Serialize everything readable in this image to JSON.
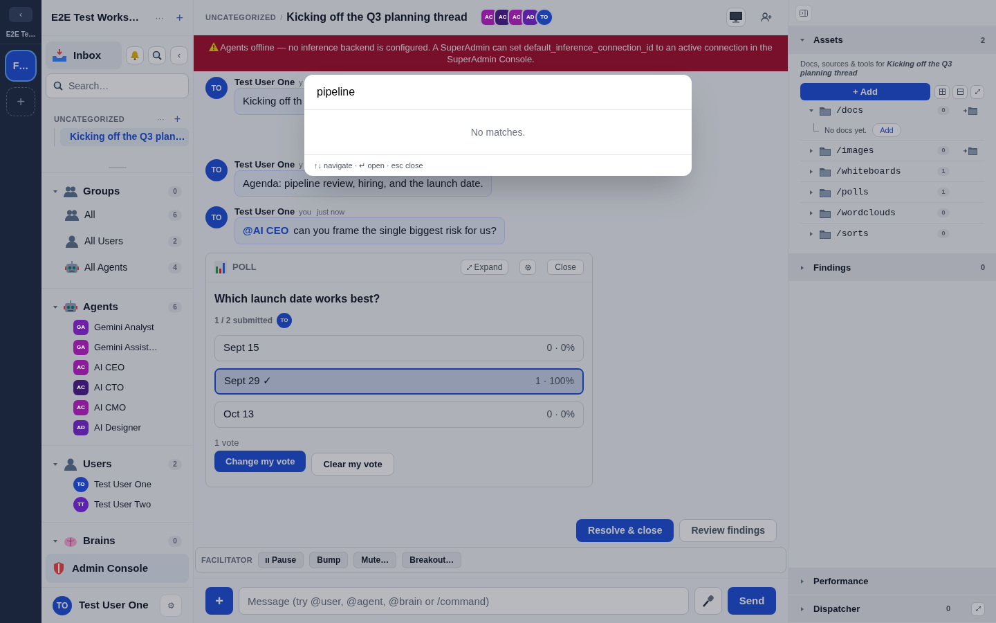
{
  "rail": {
    "back": "‹",
    "workspace_short": "E2E Te…",
    "workspaces": [
      {
        "label": "F…",
        "selected": true
      }
    ],
    "add": "+"
  },
  "sidebar": {
    "title": "E2E Test Works…",
    "more": "···",
    "add": "+",
    "inbox": "Inbox",
    "search": {
      "placeholder": "Search…"
    },
    "category": {
      "label": "UNCATEGORIZED",
      "more": "···",
      "add": "+"
    },
    "threads": [
      {
        "label": "Kicking off the Q3 plan…",
        "selected": true
      }
    ],
    "sections": [
      {
        "title": "Groups",
        "count": "0",
        "expanded": true,
        "items": [
          {
            "kind": "icon",
            "label": "All",
            "count": "6"
          },
          {
            "kind": "icon",
            "label": "All Users",
            "count": "2"
          },
          {
            "kind": "icon",
            "label": "All Agents",
            "count": "4"
          }
        ]
      },
      {
        "title": "Agents",
        "count": "6",
        "expanded": true,
        "items": [
          {
            "kind": "avatar",
            "initials": "GA",
            "label": "Gemini Analyst",
            "color": "#6b21a8"
          },
          {
            "kind": "avatar",
            "initials": "GA",
            "label": "Gemini Assist…",
            "color": "#8b1d9a"
          },
          {
            "kind": "avatar",
            "initials": "AC",
            "label": "AI CEO",
            "color": "#8b1d9a"
          },
          {
            "kind": "avatar",
            "initials": "AC",
            "label": "AI CTO",
            "color": "#3b1a6e"
          },
          {
            "kind": "avatar",
            "initials": "AC",
            "label": "AI CMO",
            "color": "#8b1d9a"
          },
          {
            "kind": "avatar",
            "initials": "AD",
            "label": "AI Designer",
            "color": "#5b21a0"
          }
        ]
      },
      {
        "title": "Users",
        "count": "2",
        "expanded": true,
        "items": [
          {
            "kind": "avatar",
            "initials": "TO",
            "label": "Test User One",
            "color": "#1e40af"
          },
          {
            "kind": "avatar",
            "initials": "TT",
            "label": "Test User Two",
            "color": "#5b23b0"
          }
        ]
      },
      {
        "title": "Brains",
        "count": "0",
        "expanded": true
      }
    ],
    "admin": "Admin Console",
    "user": {
      "initials": "TO",
      "name": "Test User One",
      "settings": "⚙"
    }
  },
  "header": {
    "category": "UNCATEGORIZED",
    "separator": "/",
    "title": "Kicking off the Q3 planning thread",
    "participants": [
      {
        "initials": "AC",
        "color": "#8b1d9a"
      },
      {
        "initials": "AC",
        "color": "#3b1a6e"
      },
      {
        "initials": "AC",
        "color": "#8b1d9a"
      },
      {
        "initials": "AD",
        "color": "#5b21a0"
      },
      {
        "initials": "TO",
        "color": "#1e40af"
      }
    ]
  },
  "banner": "Agents offline — no inference backend is configured. A SuperAdmin can set default_inference_connection_id to an active connection in the SuperAdmin Console.",
  "messages": [
    {
      "initials": "TO",
      "author": "Test User One",
      "you": "y",
      "text": "Kicking off th"
    },
    {
      "initials": "TO",
      "author": "Test User One",
      "you": "y",
      "text": "Agenda: pipeline review, hiring, and the launch date."
    },
    {
      "initials": "TO",
      "author": "Test User One",
      "you": "you",
      "time": "just now",
      "mention": "@AI CEO",
      "text": "can you frame the single biggest risk for us?"
    }
  ],
  "poll": {
    "label": "POLL",
    "expand": "Expand",
    "close": "Close",
    "question": "Which launch date works best?",
    "submitted": "1 / 2 submitted",
    "voters": [
      "TO"
    ],
    "options": [
      {
        "label": "Sept 15",
        "result": "0 · 0%",
        "selected": false,
        "level": 0
      },
      {
        "label": "Sept 29 ✓",
        "result": "1 · 100%",
        "selected": true,
        "level": 1
      },
      {
        "label": "Oct 13",
        "result": "0 · 0%",
        "selected": false,
        "level": 0
      }
    ],
    "votes": "1 vote",
    "buttons": [
      "Change my vote",
      "Clear my vote"
    ]
  },
  "actions": [
    "Resolve & close",
    "Review findings"
  ],
  "facilitator": {
    "label": "FACILITATOR",
    "buttons": [
      {
        "label": "Pause",
        "kind": "pause"
      },
      {
        "label": "Bump",
        "kind": "plain"
      },
      {
        "label": "Mute…",
        "kind": "plain"
      },
      {
        "label": "Breakout…",
        "kind": "plain"
      }
    ]
  },
  "composer": {
    "add": "+",
    "placeholder": "Message (try @user, @agent, @brain or /command)",
    "send": "Send"
  },
  "assets": {
    "title": "Assets",
    "count": "2",
    "expanded": true,
    "description": "Docs, sources & tools for *Kicking off the Q3 planning thread*",
    "add": "+ Add",
    "folders": [
      {
        "name": "/docs",
        "count": "0",
        "expanded": true,
        "add_folder": true,
        "empty": "No docs yet.",
        "empty_action": "Add"
      },
      {
        "name": "/images",
        "count": "0",
        "expanded": false,
        "add_folder": true
      },
      {
        "name": "/whiteboards",
        "count": "1",
        "expanded": false
      },
      {
        "name": "/polls",
        "count": "1",
        "expanded": false
      },
      {
        "name": "/wordclouds",
        "count": "0",
        "expanded": false
      },
      {
        "name": "/sorts",
        "count": "0",
        "expanded": false
      }
    ]
  },
  "panels": [
    {
      "title": "Findings",
      "count": "0",
      "expanded": false
    },
    {
      "title": "Performance",
      "expanded": false
    },
    {
      "title": "Dispatcher",
      "count": "0",
      "expanded": false,
      "expand_button": true
    }
  ],
  "modal": {
    "query": "pipeline",
    "empty": "No matches.",
    "hint": "↑↓ navigate · ↵ open · esc close"
  }
}
